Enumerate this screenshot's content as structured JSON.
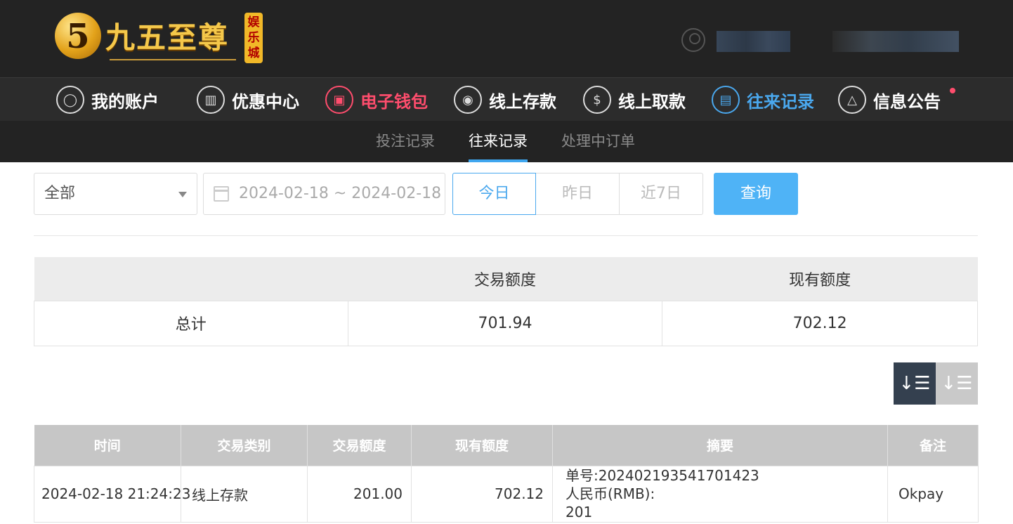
{
  "header": {
    "logo_digit": "5",
    "logo_text": "九五至尊",
    "logo_badge": "娱乐城"
  },
  "nav": {
    "items": [
      {
        "label": "我的账户",
        "icon": "user-icon",
        "glyph": "◯"
      },
      {
        "label": "优惠中心",
        "icon": "gift-icon",
        "glyph": "▥"
      },
      {
        "label": "电子钱包",
        "icon": "wallet-icon",
        "glyph": "▣"
      },
      {
        "label": "线上存款",
        "icon": "deposit-icon",
        "glyph": "◉"
      },
      {
        "label": "线上取款",
        "icon": "withdraw-icon",
        "glyph": "$"
      },
      {
        "label": "往来记录",
        "icon": "records-icon",
        "glyph": "▤"
      },
      {
        "label": "信息公告",
        "icon": "bell-icon",
        "glyph": "△"
      }
    ]
  },
  "subnav": {
    "items": [
      "投注记录",
      "往来记录",
      "处理中订单"
    ]
  },
  "filter": {
    "type_selected": "全部",
    "date_range": "2024-02-18 ~ 2024-02-18",
    "today": "今日",
    "yesterday": "昨日",
    "last7": "近7日",
    "query": "查询"
  },
  "summary": {
    "headers": [
      "",
      "交易额度",
      "现有额度"
    ],
    "row_label": "总计",
    "trade_amount": "701.94",
    "balance": "702.12"
  },
  "sort": {
    "desc_glyph": "↓☰",
    "asc_glyph": "↓☰"
  },
  "records": {
    "headers": [
      "时间",
      "交易类别",
      "交易额度",
      "现有额度",
      "摘要",
      "备注"
    ],
    "rows": [
      {
        "time": "2024-02-18 21:24:23",
        "type": "线上存款",
        "amount": "201.00",
        "balance": "702.12",
        "summary_line1": "单号:202402193541701423",
        "summary_line2": "人民币(RMB):",
        "summary_line3": "201",
        "note": "Okpay"
      }
    ]
  }
}
